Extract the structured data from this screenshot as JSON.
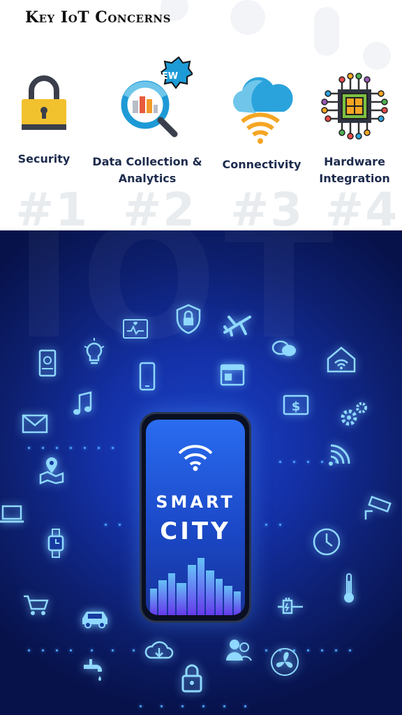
{
  "header": {
    "title": "Key IoT Concerns"
  },
  "watermark_numbers": [
    "#1",
    "#2",
    "#3",
    "#4"
  ],
  "concerns": [
    {
      "label": "Security",
      "icon": "padlock-icon"
    },
    {
      "label": "Data Collection & Analytics",
      "icon": "magnifier-chart-icon",
      "badge": "NEW"
    },
    {
      "label": "Connectivity",
      "icon": "cloud-wifi-icon"
    },
    {
      "label": "Hardware Integration",
      "icon": "chip-icon"
    }
  ],
  "phone": {
    "line1": "SMART",
    "line2": "CITY"
  },
  "background_text": "IOT",
  "colors": {
    "accent": "#1b43c9",
    "glow": "#4fc3ff",
    "lock_body": "#f2c12e",
    "badge": "#1d9bd6"
  }
}
